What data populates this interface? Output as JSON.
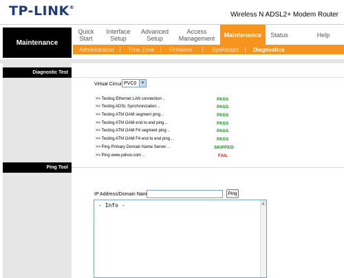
{
  "header": {
    "logo": "TP-LINK",
    "logo_mark": "®",
    "model": "Wireless N ADSL2+ Modem Router"
  },
  "nav": {
    "section_title": "Maintenance",
    "items": [
      {
        "label": "Quick\nStart"
      },
      {
        "label": "Interface\nSetup"
      },
      {
        "label": "Advanced\nSetup"
      },
      {
        "label": "Access\nManagement"
      },
      {
        "label": "Maintenance",
        "active": true
      },
      {
        "label": "Status"
      },
      {
        "label": "Help"
      }
    ],
    "sub_items": [
      {
        "label": "Administration"
      },
      {
        "label": "Time Zone"
      },
      {
        "label": "Firmware"
      },
      {
        "label": "SysRestart"
      },
      {
        "label": "Diagnostics",
        "active": true
      }
    ],
    "accent_color": "#f7941d"
  },
  "diagnostic": {
    "title": "Diagnostic Test",
    "vc_label": "Virtual Circuit",
    "vc_value": "PVC0",
    "tests": [
      {
        "label": ">> Testing Ethernet LAN connection ..",
        "result": "PASS",
        "status": "pass"
      },
      {
        "label": ">> Testing ADSL Synchronization ..",
        "result": "PASS",
        "status": "pass"
      },
      {
        "label": ">> Testing ATM OAM segment ping ..",
        "result": "PASS",
        "status": "pass"
      },
      {
        "label": ">> Testing ATM OAM end to end ping ..",
        "result": "PASS",
        "status": "pass"
      },
      {
        "label": ">> Testing ATM OAM F4 segment ping ..",
        "result": "PASS",
        "status": "pass"
      },
      {
        "label": ">> Testing ATM OAM F4 end to end ping ..",
        "result": "PASS",
        "status": "pass"
      },
      {
        "label": ">> Ping Primary Domain Name Server ..",
        "result": "SKIPPED",
        "status": "skipped"
      },
      {
        "label": ">> Ping www.yahoo.com ..",
        "result": "FAIL",
        "status": "fail"
      }
    ]
  },
  "ping": {
    "title": "Ping Tool",
    "address_label": "IP Address/Domain Name",
    "address_value": "",
    "button_label": "Ping",
    "info_text": "- Info -"
  }
}
